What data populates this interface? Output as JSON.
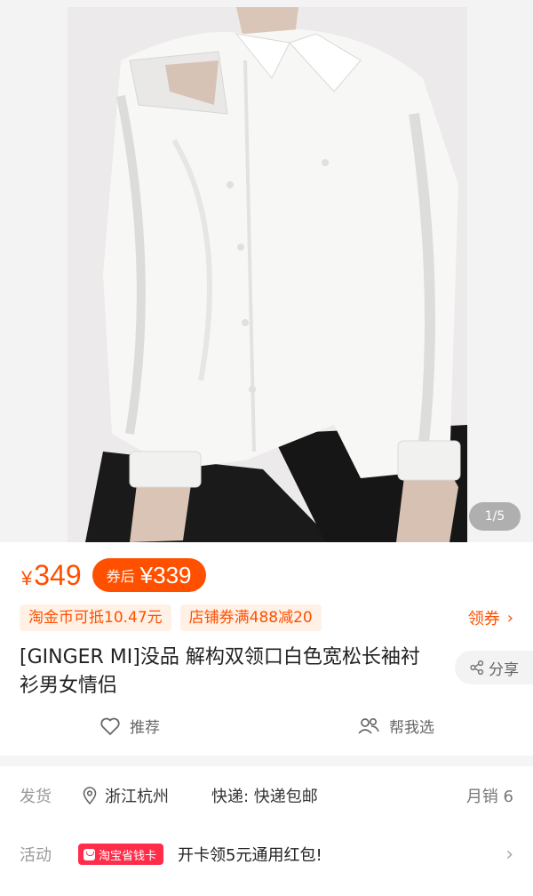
{
  "gallery": {
    "counter": "1/5"
  },
  "price": {
    "currency": "¥",
    "amount": "349"
  },
  "after_coupon": {
    "label": "券后",
    "currency": "¥",
    "amount": "339"
  },
  "promotions": [
    {
      "text": "淘金币可抵10.47元"
    },
    {
      "text": "店铺券满488减20"
    }
  ],
  "coupon_link": {
    "label": "领券",
    "chevron": "›"
  },
  "product": {
    "title": "[GINGER MI]没品 解构双领口白色宽松长袖衬衫男女情侣"
  },
  "share": {
    "label": "分享",
    "icon": "share-icon"
  },
  "actions": {
    "recommend": "推荐",
    "help_choose": "帮我选"
  },
  "shipping": {
    "label": "发货",
    "location": "浙江杭州",
    "express": "快递: 快递包邮",
    "monthly_sales": "月销 6"
  },
  "activity": {
    "label": "活动",
    "badge": "淘宝省钱卡",
    "text": "开卡领5元通用红包!",
    "arrow": "›"
  },
  "colors": {
    "accent": "#ff5000",
    "badge": "#ff2d4a"
  }
}
